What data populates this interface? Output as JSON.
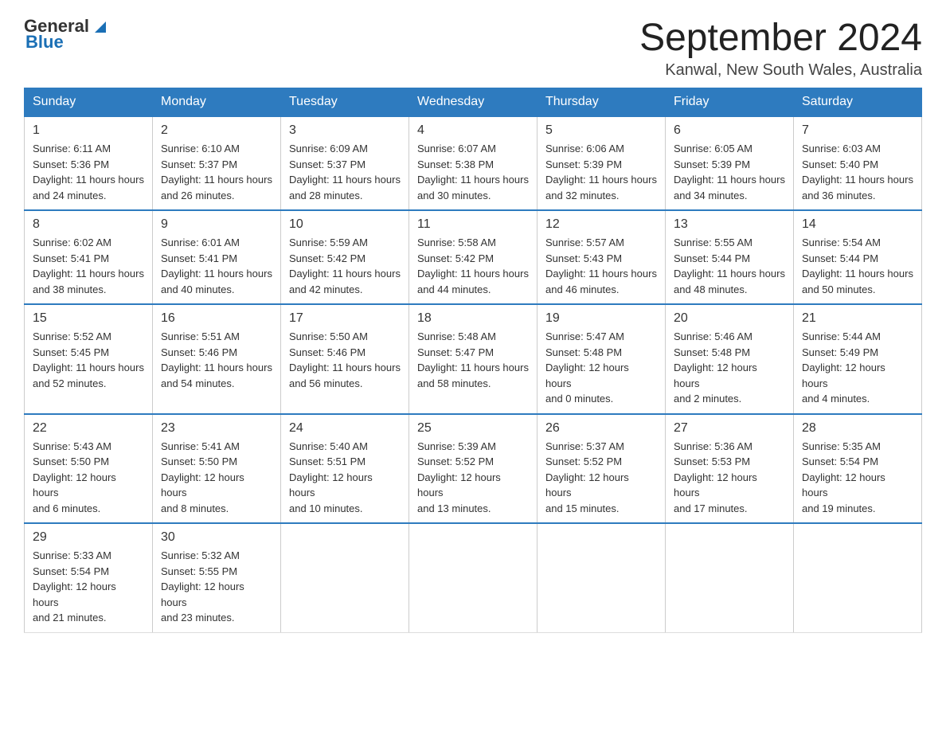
{
  "header": {
    "logo_general": "General",
    "logo_blue": "Blue",
    "month_title": "September 2024",
    "location": "Kanwal, New South Wales, Australia"
  },
  "days_of_week": [
    "Sunday",
    "Monday",
    "Tuesday",
    "Wednesday",
    "Thursday",
    "Friday",
    "Saturday"
  ],
  "weeks": [
    [
      {
        "day": "1",
        "sunrise": "6:11 AM",
        "sunset": "5:36 PM",
        "daylight": "11 hours and 24 minutes."
      },
      {
        "day": "2",
        "sunrise": "6:10 AM",
        "sunset": "5:37 PM",
        "daylight": "11 hours and 26 minutes."
      },
      {
        "day": "3",
        "sunrise": "6:09 AM",
        "sunset": "5:37 PM",
        "daylight": "11 hours and 28 minutes."
      },
      {
        "day": "4",
        "sunrise": "6:07 AM",
        "sunset": "5:38 PM",
        "daylight": "11 hours and 30 minutes."
      },
      {
        "day": "5",
        "sunrise": "6:06 AM",
        "sunset": "5:39 PM",
        "daylight": "11 hours and 32 minutes."
      },
      {
        "day": "6",
        "sunrise": "6:05 AM",
        "sunset": "5:39 PM",
        "daylight": "11 hours and 34 minutes."
      },
      {
        "day": "7",
        "sunrise": "6:03 AM",
        "sunset": "5:40 PM",
        "daylight": "11 hours and 36 minutes."
      }
    ],
    [
      {
        "day": "8",
        "sunrise": "6:02 AM",
        "sunset": "5:41 PM",
        "daylight": "11 hours and 38 minutes."
      },
      {
        "day": "9",
        "sunrise": "6:01 AM",
        "sunset": "5:41 PM",
        "daylight": "11 hours and 40 minutes."
      },
      {
        "day": "10",
        "sunrise": "5:59 AM",
        "sunset": "5:42 PM",
        "daylight": "11 hours and 42 minutes."
      },
      {
        "day": "11",
        "sunrise": "5:58 AM",
        "sunset": "5:42 PM",
        "daylight": "11 hours and 44 minutes."
      },
      {
        "day": "12",
        "sunrise": "5:57 AM",
        "sunset": "5:43 PM",
        "daylight": "11 hours and 46 minutes."
      },
      {
        "day": "13",
        "sunrise": "5:55 AM",
        "sunset": "5:44 PM",
        "daylight": "11 hours and 48 minutes."
      },
      {
        "day": "14",
        "sunrise": "5:54 AM",
        "sunset": "5:44 PM",
        "daylight": "11 hours and 50 minutes."
      }
    ],
    [
      {
        "day": "15",
        "sunrise": "5:52 AM",
        "sunset": "5:45 PM",
        "daylight": "11 hours and 52 minutes."
      },
      {
        "day": "16",
        "sunrise": "5:51 AM",
        "sunset": "5:46 PM",
        "daylight": "11 hours and 54 minutes."
      },
      {
        "day": "17",
        "sunrise": "5:50 AM",
        "sunset": "5:46 PM",
        "daylight": "11 hours and 56 minutes."
      },
      {
        "day": "18",
        "sunrise": "5:48 AM",
        "sunset": "5:47 PM",
        "daylight": "11 hours and 58 minutes."
      },
      {
        "day": "19",
        "sunrise": "5:47 AM",
        "sunset": "5:48 PM",
        "daylight": "12 hours and 0 minutes."
      },
      {
        "day": "20",
        "sunrise": "5:46 AM",
        "sunset": "5:48 PM",
        "daylight": "12 hours and 2 minutes."
      },
      {
        "day": "21",
        "sunrise": "5:44 AM",
        "sunset": "5:49 PM",
        "daylight": "12 hours and 4 minutes."
      }
    ],
    [
      {
        "day": "22",
        "sunrise": "5:43 AM",
        "sunset": "5:50 PM",
        "daylight": "12 hours and 6 minutes."
      },
      {
        "day": "23",
        "sunrise": "5:41 AM",
        "sunset": "5:50 PM",
        "daylight": "12 hours and 8 minutes."
      },
      {
        "day": "24",
        "sunrise": "5:40 AM",
        "sunset": "5:51 PM",
        "daylight": "12 hours and 10 minutes."
      },
      {
        "day": "25",
        "sunrise": "5:39 AM",
        "sunset": "5:52 PM",
        "daylight": "12 hours and 13 minutes."
      },
      {
        "day": "26",
        "sunrise": "5:37 AM",
        "sunset": "5:52 PM",
        "daylight": "12 hours and 15 minutes."
      },
      {
        "day": "27",
        "sunrise": "5:36 AM",
        "sunset": "5:53 PM",
        "daylight": "12 hours and 17 minutes."
      },
      {
        "day": "28",
        "sunrise": "5:35 AM",
        "sunset": "5:54 PM",
        "daylight": "12 hours and 19 minutes."
      }
    ],
    [
      {
        "day": "29",
        "sunrise": "5:33 AM",
        "sunset": "5:54 PM",
        "daylight": "12 hours and 21 minutes."
      },
      {
        "day": "30",
        "sunrise": "5:32 AM",
        "sunset": "5:55 PM",
        "daylight": "12 hours and 23 minutes."
      },
      null,
      null,
      null,
      null,
      null
    ]
  ],
  "labels": {
    "sunrise": "Sunrise:",
    "sunset": "Sunset:",
    "daylight": "Daylight:"
  }
}
